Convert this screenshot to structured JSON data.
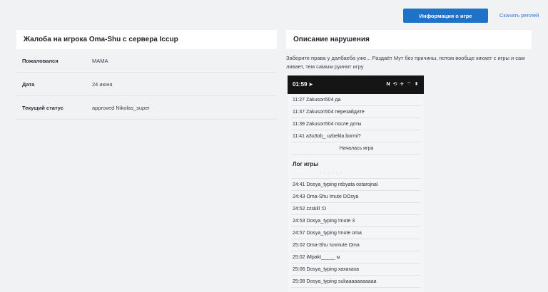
{
  "header": {
    "info_button": "Информация о игре",
    "replay_link": "Скачать реплей"
  },
  "complaint": {
    "title": "Жалоба на игрока Oma-Shu с сервера Iccup",
    "rows": [
      {
        "label": "Пожаловался",
        "value": "MAMA"
      },
      {
        "label": "Дата",
        "value": "24 июня"
      },
      {
        "label": "Текущий статус",
        "value": "approved Nikolas_super"
      }
    ]
  },
  "violation": {
    "title": "Описание нарушения",
    "description": "Заберите права у далбаеба уже... Раздаёт Мут без причины, потом вообще кикает с игры и сам ливает, тем самым руинит игру"
  },
  "screenshot": {
    "time": "01:59",
    "time_icon": "navigation-arrow-icon",
    "status_icons": "𝐍 ⟲ ✈ ⌔ ▮",
    "chat": [
      "11:27 Zakuson504 да",
      "11:37 Zakuson504 перезайдите",
      "11:39 Zakuson504 после доты",
      "11:41 a3u3ob_ uzbekla bormi?"
    ],
    "game_started": "Началась игра",
    "log_title": "Лог игры",
    "log": [
      "24:41 Dosya_typing rebyata ostarojna\\",
      "24:43 Oma-Shu !mute DOsya",
      "24:52 zzskill :D",
      "24:53 Dosya_typing !mute 3",
      "24:57 Dosya_typing !mute oma",
      "25:02 Oma-Shu !unmute Oma",
      "25:02 iMpakt_____ ы",
      "25:06 Dosya_typing хахахаха",
      "25:08 Dosya_typing sukaaaaaaaaaaa"
    ]
  }
}
